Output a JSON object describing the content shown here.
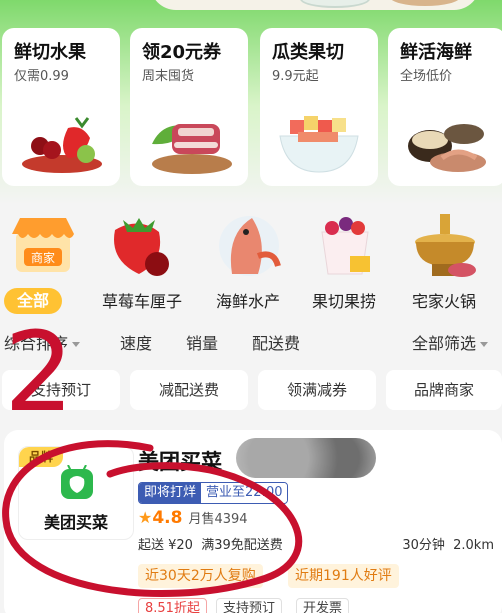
{
  "promos": [
    {
      "title": "鲜切水果",
      "subtitle": "仅需0.99"
    },
    {
      "title": "领20元券",
      "subtitle": "周末囤货"
    },
    {
      "title": "瓜类果切",
      "subtitle": "9.9元起"
    },
    {
      "title": "鲜活海鲜",
      "subtitle": "全场低价"
    }
  ],
  "categories": [
    {
      "label": "全部",
      "badge": "商家"
    },
    {
      "label": "草莓车厘子"
    },
    {
      "label": "海鲜水产"
    },
    {
      "label": "果切果捞"
    },
    {
      "label": "宅家火锅"
    }
  ],
  "sort": {
    "composite": "综合排序",
    "speed": "速度",
    "sales": "销量",
    "delivery_fee": "配送费",
    "filter": "全部筛选"
  },
  "chips": [
    "支持预订",
    "减配送费",
    "领满减券",
    "品牌商家"
  ],
  "store": {
    "brand_tag": "品牌",
    "logo_text": "美团买菜",
    "name": "美团买菜",
    "status_tag": "即将打烊",
    "hours_tag": "营业至22:00",
    "rating": "4.8",
    "monthly_sales": "月售4394",
    "min_order": "起送 ¥20",
    "free_delivery": "满39免配送费",
    "delivery_time": "30分钟",
    "distance": "2.0km",
    "promo_1": "近30天2万人复购",
    "promo_2": "近期191人好评",
    "discount": "8.51折起",
    "tag_reserve": "支持预订",
    "tag_invoice": "开发票"
  },
  "annotation": {
    "number": "2"
  },
  "colors": {
    "brand_green": "#2db84d",
    "accent_yellow": "#ffc233",
    "tag_blue": "#3d5cb3",
    "promo_orange": "#e07b12",
    "annotation_red": "#c8102e"
  }
}
